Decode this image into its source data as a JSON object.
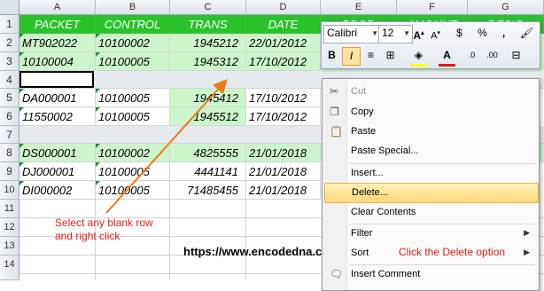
{
  "columns": [
    "A",
    "B",
    "C",
    "D",
    "E",
    "F",
    "G"
  ],
  "rows": [
    "1",
    "2",
    "3",
    "4",
    "5",
    "6",
    "7",
    "8",
    "9",
    "10",
    "11",
    "12",
    "13",
    "14"
  ],
  "headers": [
    "PACKET",
    "CONTROL",
    "TRANS",
    "DATE",
    "PROD",
    "AMOUNT",
    "DESIG"
  ],
  "data_rows": {
    "r2": [
      "MT902022",
      "10100002",
      "1945212",
      "22/01/2012"
    ],
    "r3": [
      "10100004",
      "10100005",
      "1945312",
      "17/10/2012"
    ],
    "r5": [
      "DA000001",
      "10100005",
      "1945412",
      "17/10/2012"
    ],
    "r6": [
      "11550002",
      "10100005",
      "1945512",
      "17/10/2012"
    ],
    "r8": [
      "DS000001",
      "10100002",
      "4825555",
      "21/01/2018"
    ],
    "r9": [
      "DJ000001",
      "10100005",
      "4441141",
      "21/01/2018"
    ],
    "r10": [
      "DI000002",
      "10100005",
      "71485455",
      "21/01/2018"
    ]
  },
  "mini_toolbar": {
    "font": "Calibri",
    "size": "12",
    "currency": "$",
    "percent": "%",
    "comma": ",",
    "bold": "B",
    "italic": "I",
    "align": "≡",
    "font_color": "A",
    "dec_inc": ".0",
    "dec_dec": ".00"
  },
  "menu": {
    "cut": "Cut",
    "copy": "Copy",
    "paste": "Paste",
    "paste_special": "Paste Special...",
    "insert": "Insert...",
    "delete": "Delete...",
    "clear": "Clear Contents",
    "filter": "Filter",
    "sort": "Sort",
    "insert_comment": "Insert Comment"
  },
  "annotations": {
    "select_row": "Select any blank row\nand right click",
    "click_delete": "Click the Delete option",
    "url": "https://www.encodedna.com"
  },
  "colors": {
    "header_green": "#29c329",
    "light_green": "#ccf5cc",
    "annotation_red": "#e0201b",
    "arrow_orange": "#f07a1a"
  }
}
